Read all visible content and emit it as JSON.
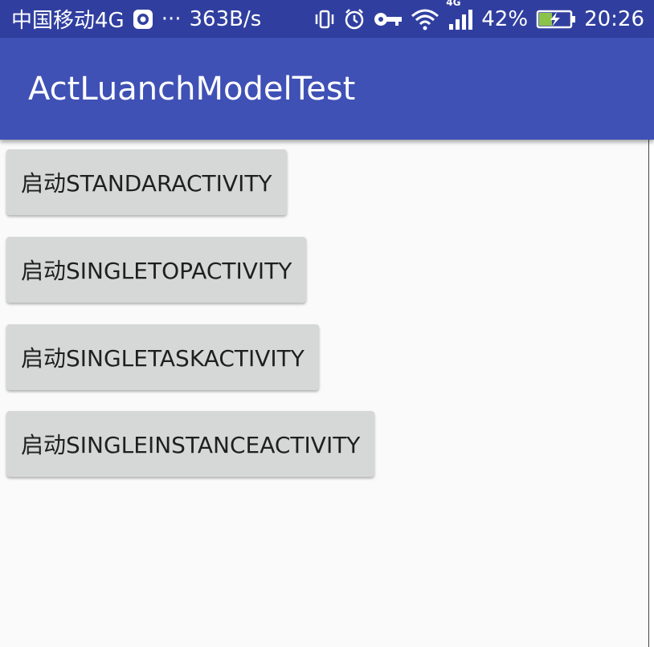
{
  "status_bar": {
    "carrier": "中国移动4G",
    "more": "···",
    "speed": "363B/s",
    "network": "4G",
    "battery_percent": "42%",
    "time": "20:26",
    "battery_level": 0.42
  },
  "app_bar": {
    "title": "ActLuanchModelTest"
  },
  "buttons": [
    {
      "label": "启动STANDARACTIVITY"
    },
    {
      "label": "启动SINGLETOPACTIVITY"
    },
    {
      "label": "启动SINGLETASKACTIVITY"
    },
    {
      "label": "启动SINGLEINSTANCEACTIVITY"
    }
  ],
  "colors": {
    "status_bar": "#303f9f",
    "app_bar": "#3f51b5",
    "button": "#d6d7d7",
    "background": "#fafafa",
    "battery_fill": "#8bc34a"
  },
  "icons": [
    "app-notification-icon",
    "vibrate-icon",
    "alarm-icon",
    "key-icon",
    "wifi-icon",
    "signal-icon",
    "battery-charging-icon"
  ]
}
